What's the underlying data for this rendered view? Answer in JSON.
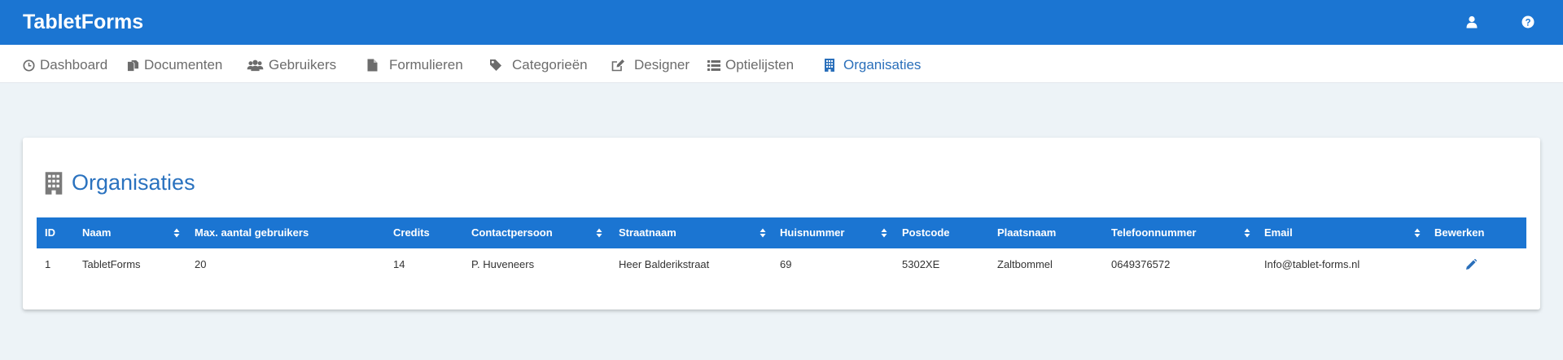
{
  "app": {
    "title": "TabletForms"
  },
  "topbar": {
    "icons": [
      "user-icon",
      "help-icon"
    ]
  },
  "nav": {
    "items": [
      {
        "label": "Dashboard",
        "icon": "clock-icon",
        "active": false
      },
      {
        "label": "Documenten",
        "icon": "documents-icon",
        "active": false
      },
      {
        "label": "Gebruikers",
        "icon": "users-icon",
        "active": false
      },
      {
        "label": "Formulieren",
        "icon": "file-icon",
        "active": false
      },
      {
        "label": "Categorieën",
        "icon": "tag-icon",
        "active": false
      },
      {
        "label": "Designer",
        "icon": "edit-icon",
        "active": false
      },
      {
        "label": "Optielijsten",
        "icon": "list-icon",
        "active": false
      },
      {
        "label": "Organisaties",
        "icon": "building-icon",
        "active": true
      }
    ]
  },
  "page": {
    "title": "Organisaties",
    "title_icon": "building-icon"
  },
  "colors": {
    "primary": "#1b75d2",
    "title": "#2a72bf",
    "background": "#edf3f7",
    "nav_text": "#6c6c6c"
  },
  "table": {
    "columns": [
      "ID",
      "Naam",
      "Max. aantal gebruikers",
      "Credits",
      "Contactpersoon",
      "Straatnaam",
      "Huisnummer",
      "Postcode",
      "Plaatsnaam",
      "Telefoonnummer",
      "Email",
      "Bewerken"
    ],
    "rows": [
      [
        "1",
        "TabletForms",
        "20",
        "14",
        "P. Huveneers",
        "Heer Balderikstraat",
        "69",
        "5302XE",
        "Zaltbommel",
        "0649376572",
        "Info@tablet-forms.nl"
      ]
    ],
    "row_action_icon": "pencil-icon"
  }
}
